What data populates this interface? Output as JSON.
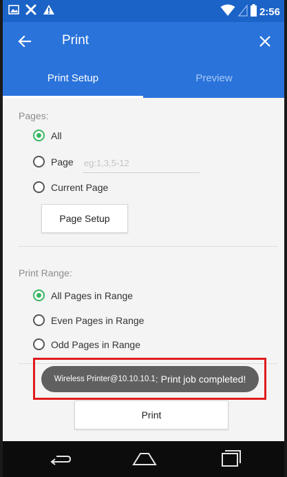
{
  "status_bar": {
    "time": "2:56"
  },
  "app_bar": {
    "title": "Print"
  },
  "tabs": [
    {
      "label": "Print Setup",
      "active": true
    },
    {
      "label": "Preview",
      "active": false
    }
  ],
  "pages_section": {
    "label": "Pages:",
    "options": [
      {
        "label": "All",
        "checked": true
      },
      {
        "label": "Page",
        "checked": false
      },
      {
        "label": "Current Page",
        "checked": false
      }
    ],
    "page_input_placeholder": "eg:1,3,5-12",
    "page_setup_button": "Page Setup"
  },
  "range_section": {
    "label": "Print Range:",
    "options": [
      {
        "label": "All Pages in Range",
        "checked": true
      },
      {
        "label": "Even Pages in Range",
        "checked": false
      },
      {
        "label": "Odd Pages in Range",
        "checked": false
      }
    ]
  },
  "toast": {
    "printer": "Wireless Printer@10.10.10.1",
    "message": " : Print job completed!"
  },
  "print_button": "Print",
  "colors": {
    "status_bar": "#1c63c8",
    "app_bar": "#2a73db",
    "radio_checked": "#35b55e",
    "highlight_border": "#e01b1b",
    "toast_bg": "#606060"
  },
  "icons": {
    "status_left": [
      "image-icon",
      "tools-icon",
      "warning-icon"
    ],
    "status_right": [
      "wifi-icon",
      "battery-icon"
    ],
    "app_bar": [
      "back-arrow-icon",
      "close-icon"
    ],
    "nav": [
      "back-nav-icon",
      "home-nav-icon",
      "recents-nav-icon"
    ]
  }
}
